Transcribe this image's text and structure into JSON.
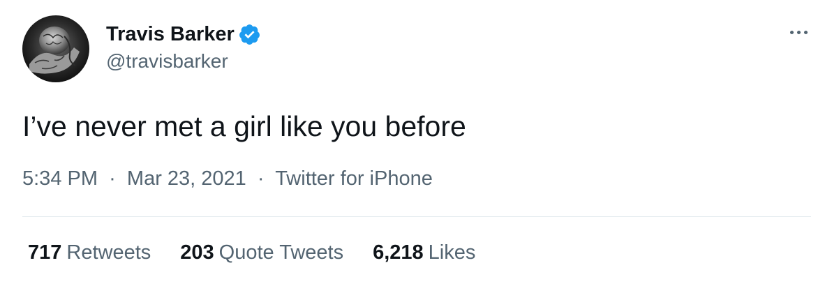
{
  "author": {
    "display_name": "Travis Barker",
    "handle": "@travisbarker",
    "verified": true,
    "verified_color": "#1d9bf0"
  },
  "more_icon": "more-horizontal-icon",
  "tweet": {
    "text": "I’ve never met a girl like you before"
  },
  "meta": {
    "time": "5:34 PM",
    "separator": "·",
    "date": "Mar 23, 2021",
    "source": "Twitter for iPhone"
  },
  "stats": {
    "retweets_count": "717",
    "retweets_label": "Retweets",
    "quotes_count": "203",
    "quotes_label": "Quote Tweets",
    "likes_count": "6,218",
    "likes_label": "Likes"
  }
}
